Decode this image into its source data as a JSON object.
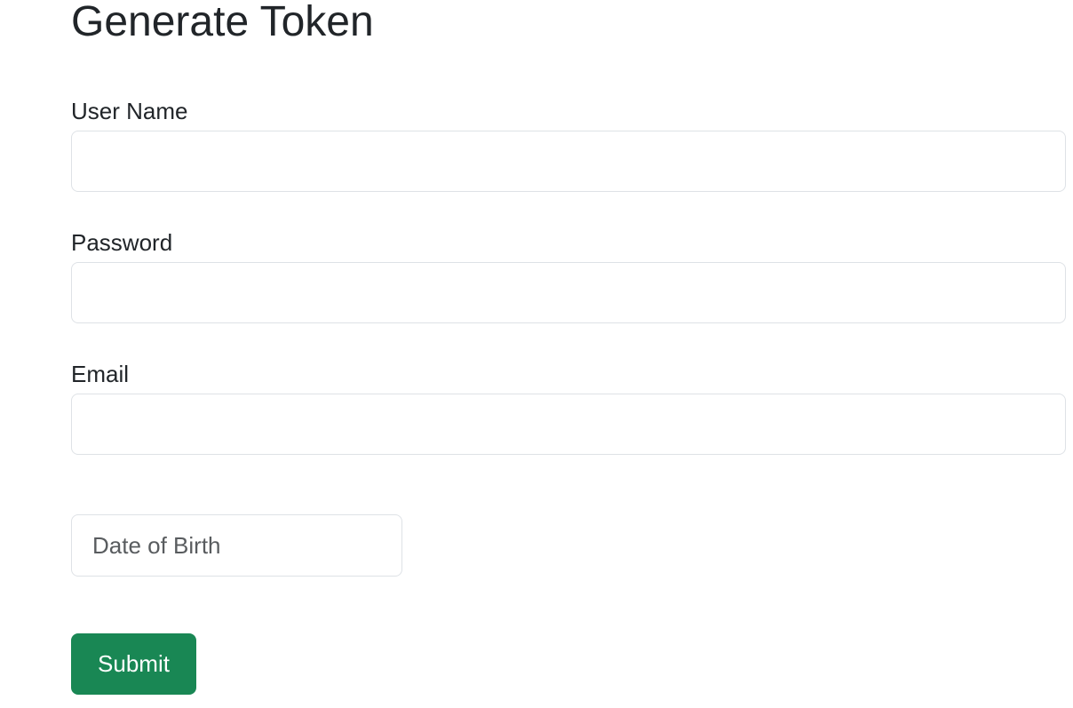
{
  "form": {
    "title": "Generate Token",
    "username": {
      "label": "User Name",
      "value": ""
    },
    "password": {
      "label": "Password",
      "value": ""
    },
    "email": {
      "label": "Email",
      "value": ""
    },
    "dob": {
      "placeholder": "Date of Birth",
      "value": ""
    },
    "submit_label": "Submit"
  },
  "colors": {
    "submit_bg": "#198754",
    "input_border": "#dee2e6",
    "text": "#212529"
  }
}
